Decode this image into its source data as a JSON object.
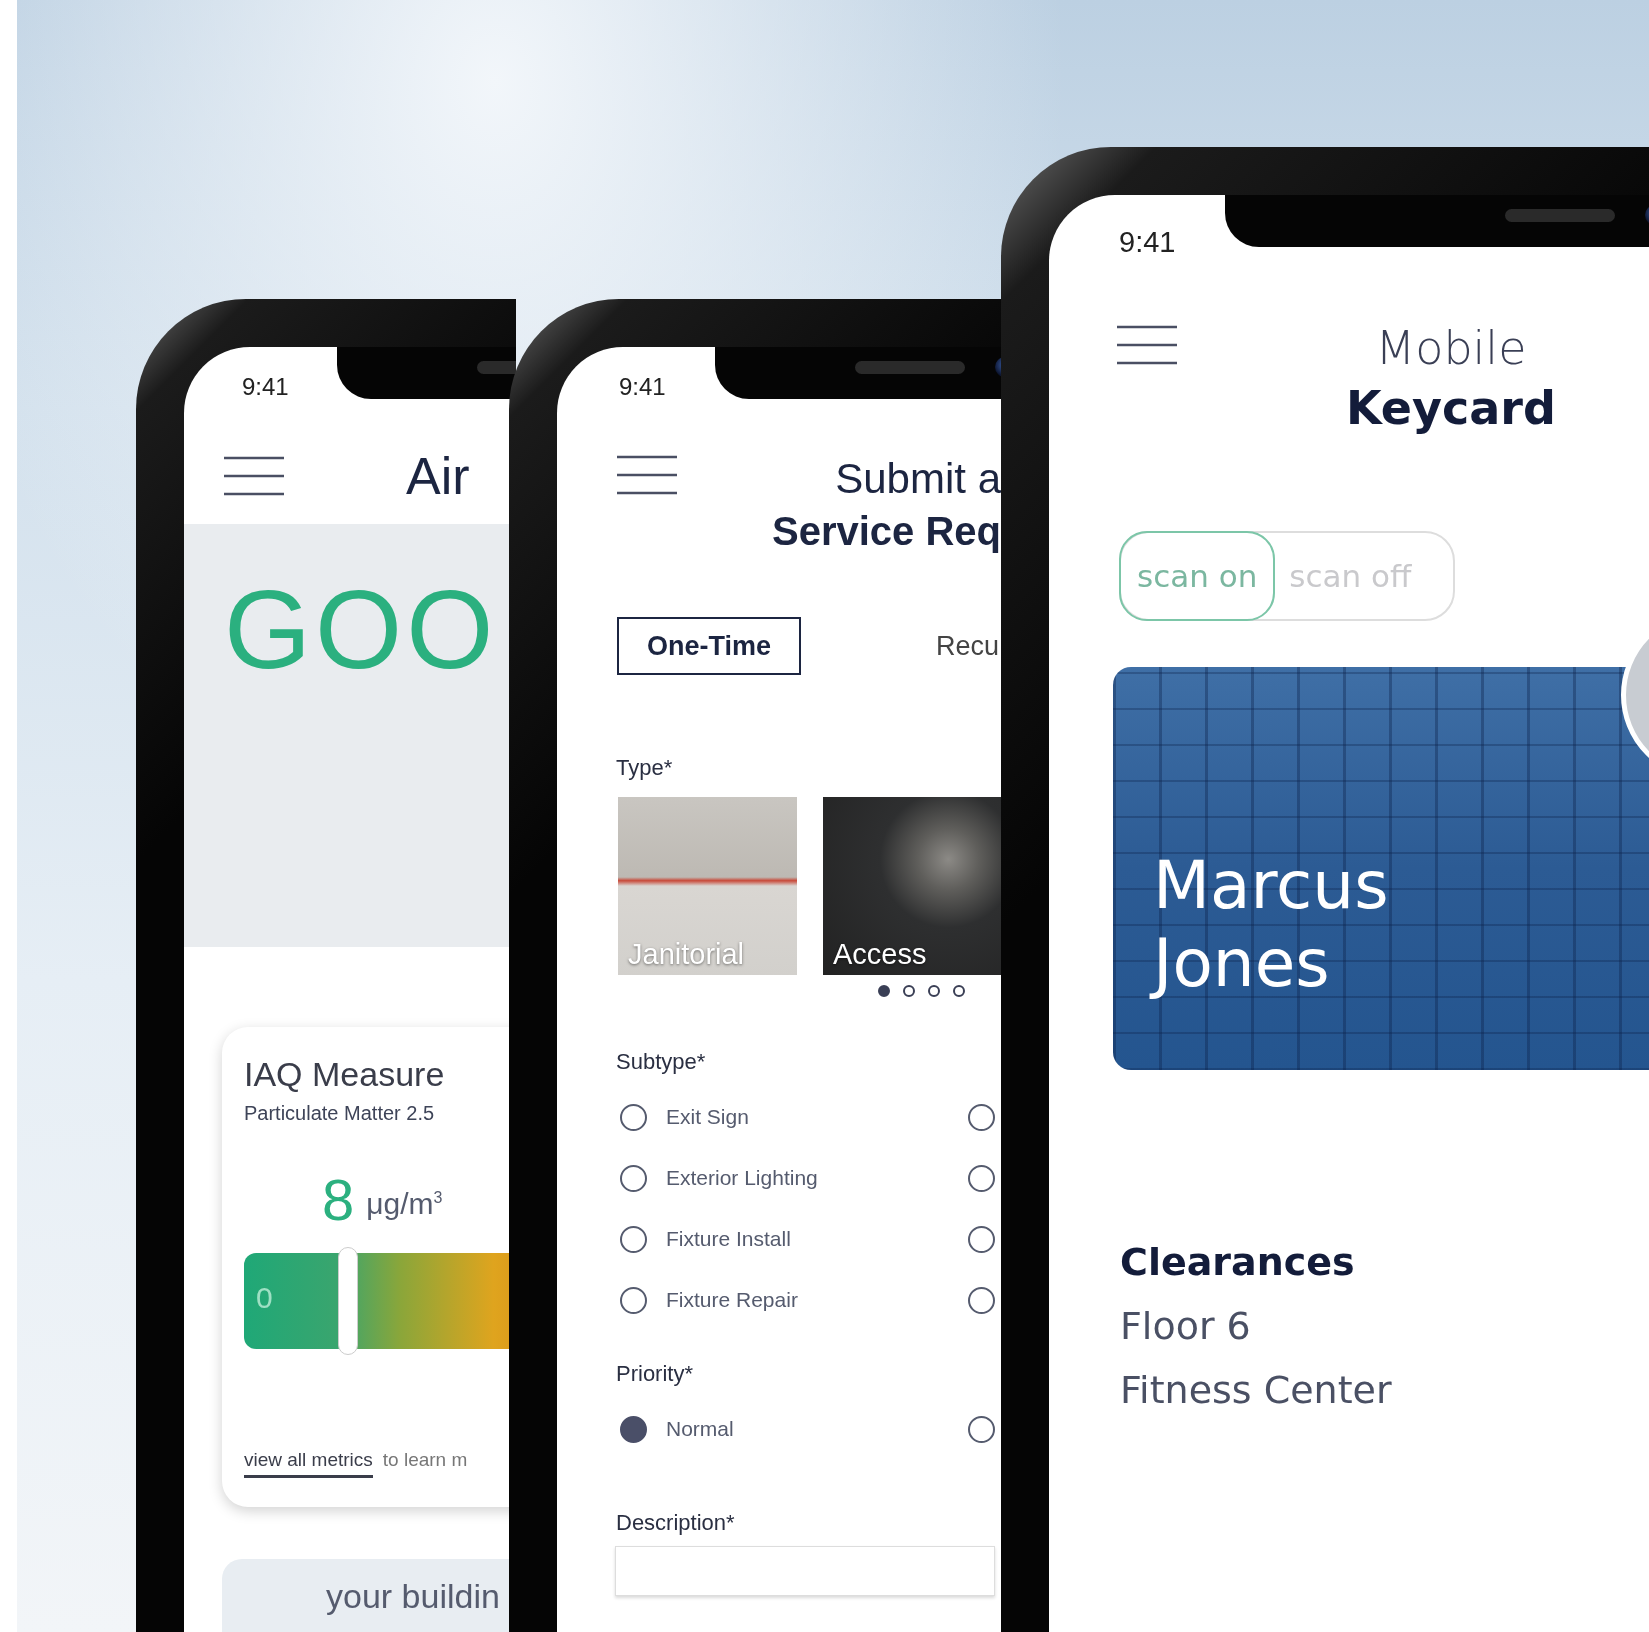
{
  "phones": [
    {
      "kind": "air_quality",
      "status_time": "9:41",
      "title": "Air",
      "status_word": "GOO",
      "card": {
        "title": "IAQ Measure",
        "subtitle": "Particulate Matter 2.5",
        "value": "8",
        "unit": "μg/m$^{3}$",
        "scale_start": "0",
        "level": 0.2,
        "link": "view all metrics",
        "link_suffix": "to learn m"
      },
      "notice": {
        "text": "your buildin"
      }
    },
    {
      "kind": "service_request",
      "status_time": "9:41",
      "title_light": "Submit a",
      "title_bold": "Service Req",
      "tabs": [
        {
          "label": "One-Time",
          "selected": true
        },
        {
          "label": "Recu",
          "selected": false
        }
      ],
      "type_label": "Type*",
      "types": [
        {
          "label": "Janitorial"
        },
        {
          "label": "Access"
        }
      ],
      "pages": [
        {
          "selected": true
        },
        {
          "selected": false
        },
        {
          "selected": false
        },
        {
          "selected": false
        }
      ],
      "subtype_label": "Subtype*",
      "subtypes": [
        {
          "label": "Exit Sign",
          "selected": false
        },
        {
          "selected": false
        },
        {
          "label": "Exterior Lighting",
          "selected": false
        },
        {
          "selected": false
        },
        {
          "label": "Fixture Install",
          "selected": false
        },
        {
          "selected": false
        },
        {
          "label": "Fixture Repair",
          "selected": false
        },
        {
          "selected": false
        }
      ],
      "priority_label": "Priority*",
      "priorities": [
        {
          "label": "Normal",
          "selected": true
        },
        {
          "selected": false
        }
      ],
      "description_label": "Description*"
    },
    {
      "kind": "keycard",
      "status_time": "9:41",
      "title_light": "Mobile",
      "title_bold": "Keycard",
      "scan": [
        {
          "label": "scan on",
          "selected": true
        },
        {
          "label": "scan off",
          "selected": false
        }
      ],
      "holder": "Marcus Jones",
      "clearances": {
        "title": "Clearances",
        "items": [
          "Floor 6",
          "Fitness Center"
        ]
      }
    }
  ]
}
